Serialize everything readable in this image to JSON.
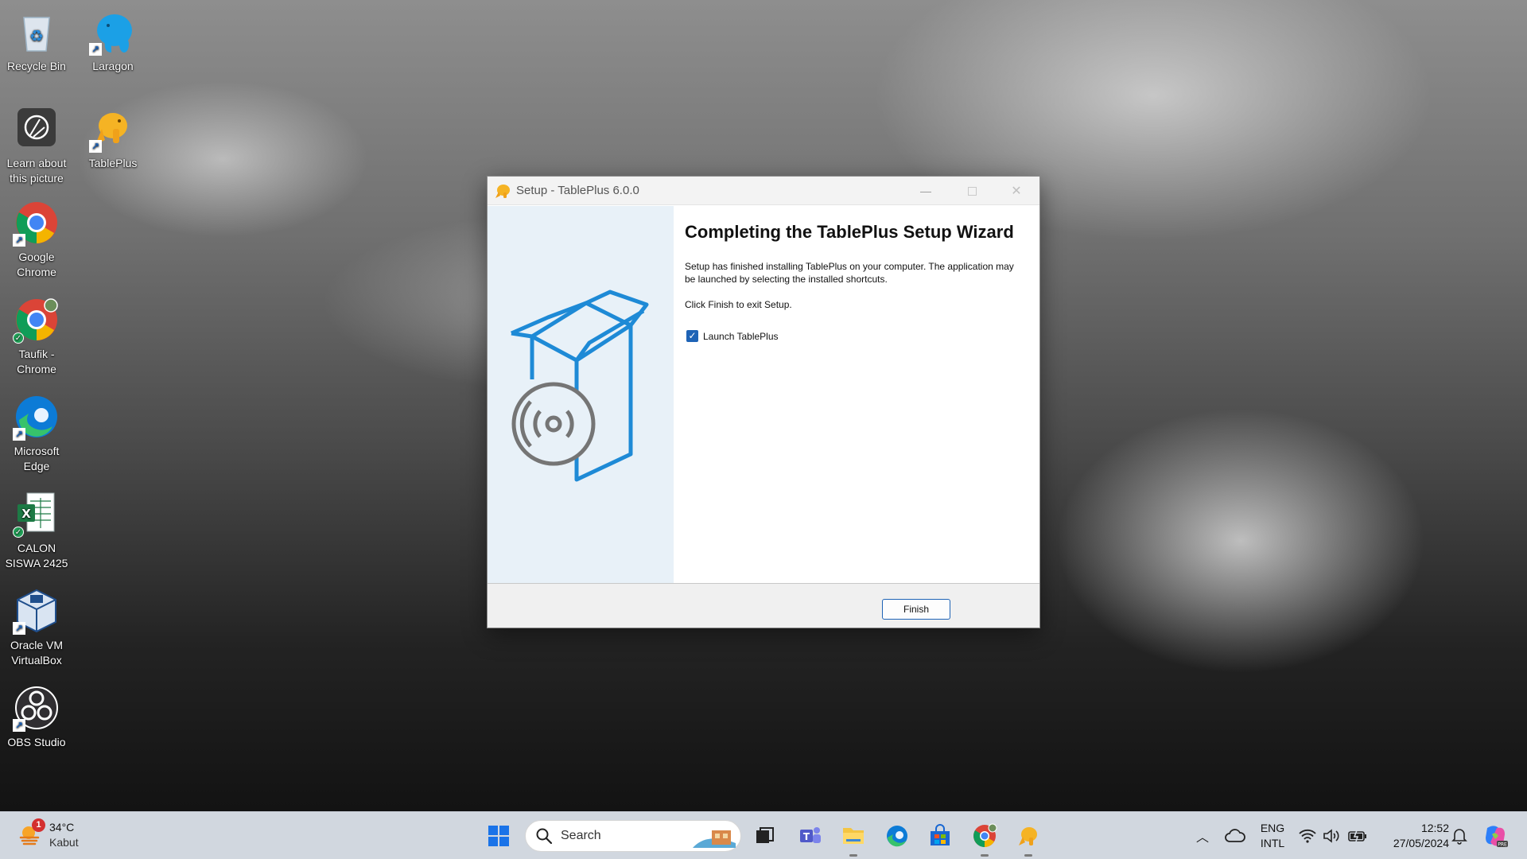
{
  "desktop": {
    "icons": [
      {
        "label": "Recycle Bin"
      },
      {
        "label": "Laragon"
      },
      {
        "label": "Learn about this picture"
      },
      {
        "label": "TablePlus"
      },
      {
        "label": "Google Chrome"
      },
      {
        "label": "Taufik - Chrome"
      },
      {
        "label": "Microsoft Edge"
      },
      {
        "label": "CALON SISWA  2425"
      },
      {
        "label": "Oracle VM VirtualBox"
      },
      {
        "label": "OBS Studio"
      }
    ]
  },
  "dialog": {
    "title": "Setup - TablePlus 6.0.0",
    "heading": "Completing the TablePlus Setup Wizard",
    "paragraph1": "Setup has finished installing TablePlus on your computer. The application may be launched by selecting the installed shortcuts.",
    "paragraph2": "Click Finish to exit Setup.",
    "checkbox_label": "Launch TablePlus",
    "checkbox_checked": true,
    "finish_label": "Finish"
  },
  "taskbar": {
    "weather": {
      "temp": "34°C",
      "condition": "Kabut",
      "badge": "1"
    },
    "search_placeholder": "Search",
    "language": {
      "lang": "ENG",
      "layout": "INTL"
    },
    "clock": {
      "time": "12:52",
      "date": "27/05/2024"
    }
  },
  "colors": {
    "accent": "#1e63b6",
    "side_panel": "#e8f1f8"
  }
}
